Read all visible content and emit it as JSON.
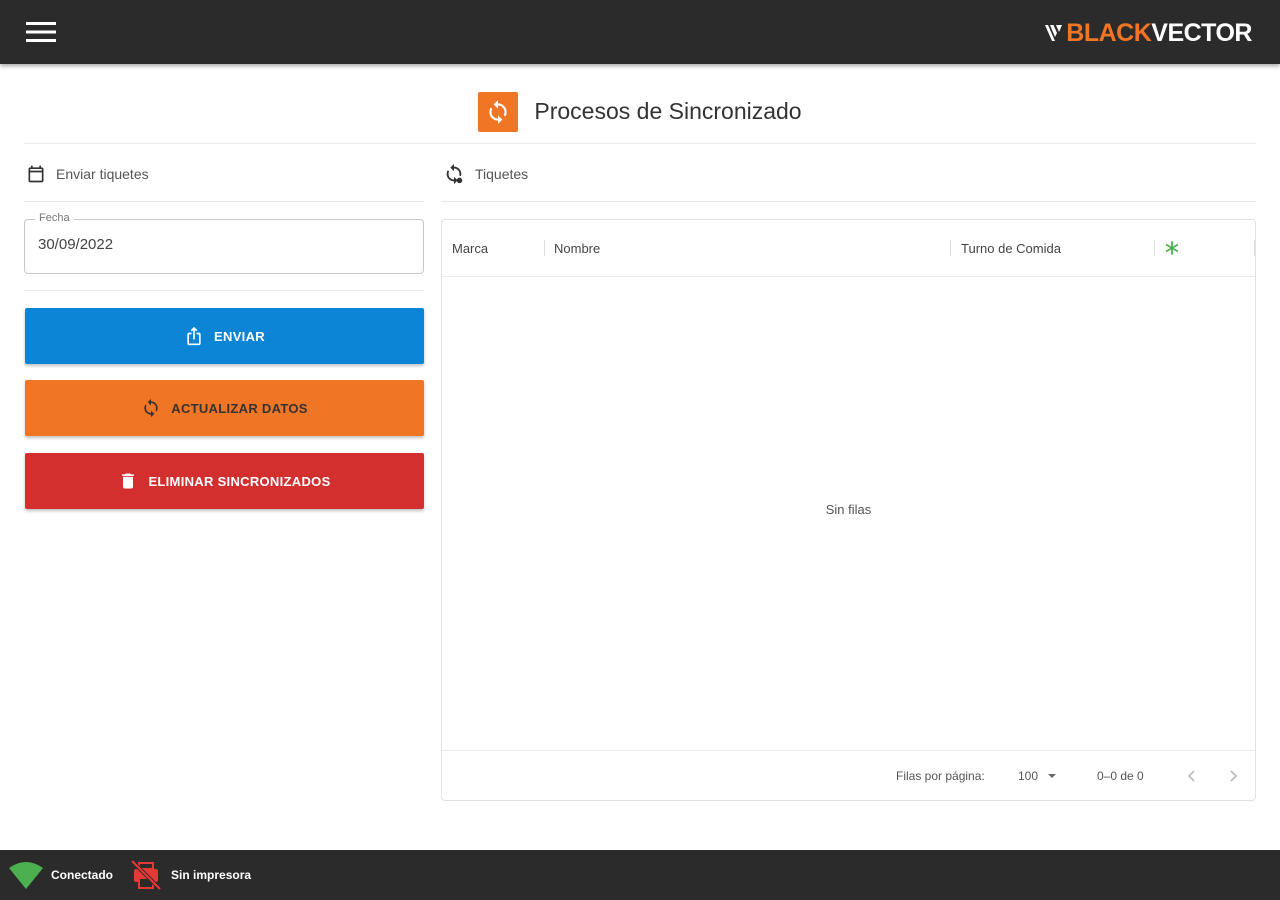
{
  "app": {
    "logo_black": "BLACK",
    "logo_vector": "VECTOR"
  },
  "page": {
    "title": "Procesos de Sincronizado"
  },
  "left": {
    "section_title": "Enviar tiquetes",
    "date_label": "Fecha",
    "date_value": "30/09/2022",
    "send_label": "ENVIAR",
    "update_label": "ACTUALIZAR DATOS",
    "delete_label": "ELIMINAR SINCRONIZADOS"
  },
  "right": {
    "section_title": "Tiquetes",
    "columns": [
      "Marca",
      "Nombre",
      "Turno de Comida"
    ],
    "empty_text": "Sin filas",
    "rows_per_page_label": "Filas por página:",
    "rows_per_page_value": "100",
    "range_text": "0–0 de 0"
  },
  "status": {
    "connection": "Conectado",
    "printer": "Sin impresora"
  },
  "colors": {
    "topbar": "#2b2b2b",
    "accent_orange": "#f07524",
    "send_blue": "#0a84d4",
    "delete_red": "#d32f2f",
    "connected_green": "#4caf50",
    "printer_red": "#e53935"
  },
  "icons": {
    "menu": "menu-icon",
    "title": "sync-icon",
    "calendar": "calendar-icon",
    "tickets": "ticket-sync-icon",
    "send": "share-icon",
    "update": "sync-icon",
    "delete": "trash-icon",
    "column_action": "asterisk-icon",
    "wifi": "wifi-icon",
    "printer_off": "printer-off-icon"
  }
}
